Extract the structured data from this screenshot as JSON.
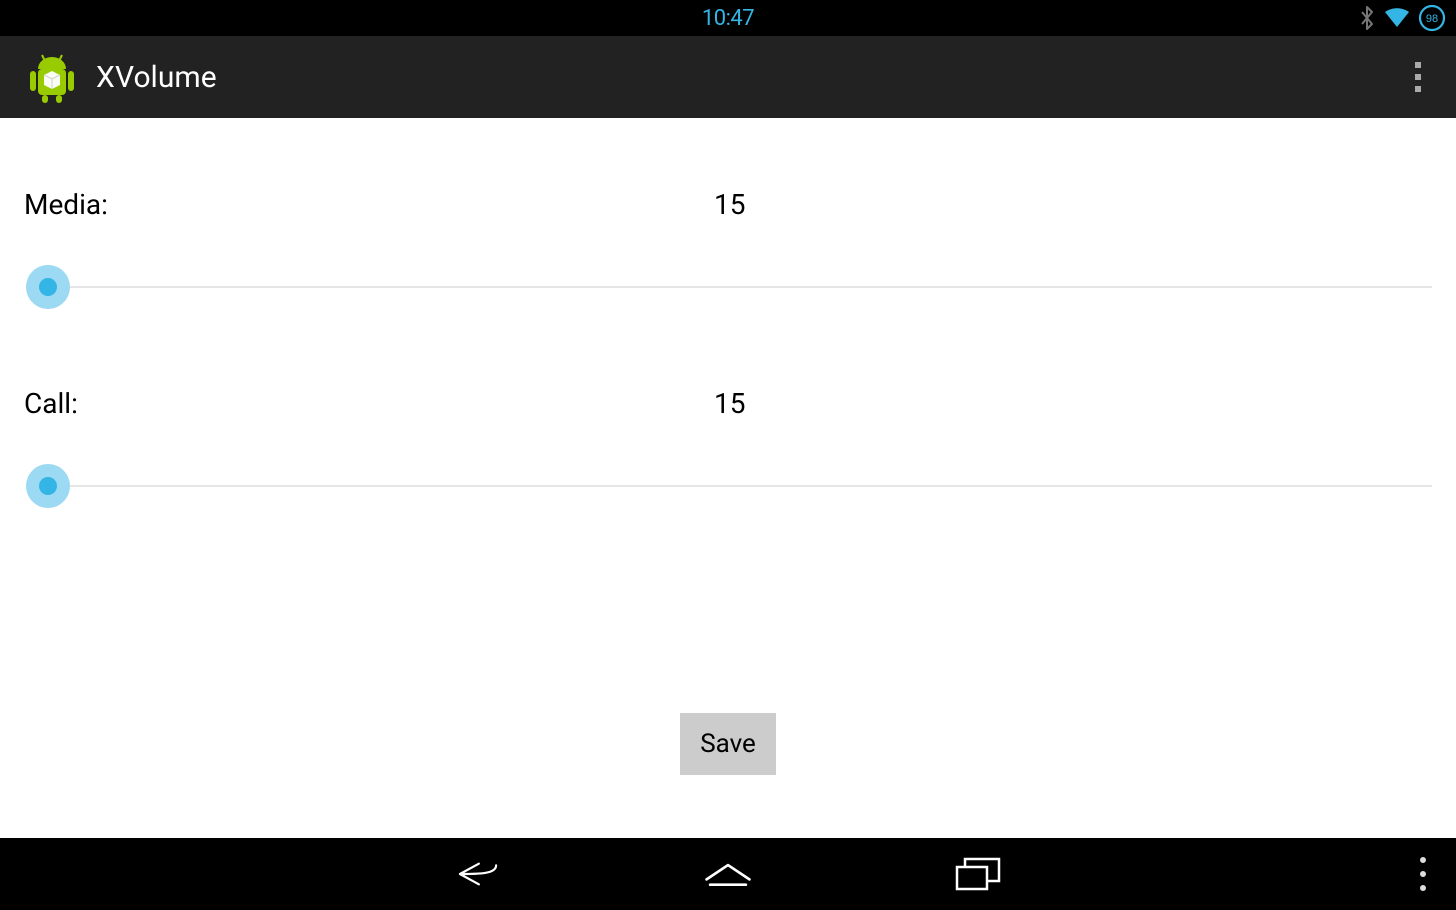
{
  "status_bar": {
    "time": "10:47",
    "battery": "98"
  },
  "action_bar": {
    "title": "XVolume"
  },
  "sliders": {
    "media": {
      "label": "Media:",
      "value": "15"
    },
    "call": {
      "label": "Call:",
      "value": "15"
    }
  },
  "buttons": {
    "save": "Save"
  }
}
